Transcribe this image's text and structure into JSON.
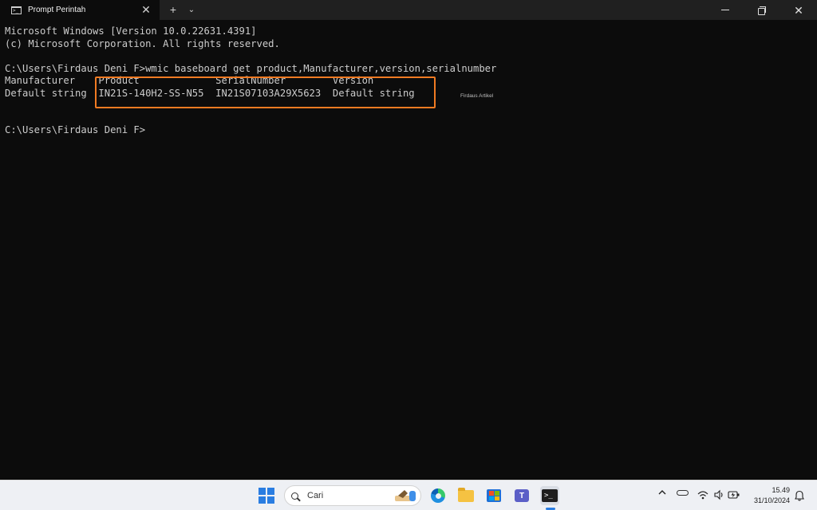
{
  "window": {
    "tab_title": "Prompt Perintah",
    "tab_icon": "terminal-icon",
    "tab_close_glyph": "✕",
    "new_tab_glyph": "+",
    "dropdown_glyph": "⌄",
    "close_glyph": "✕"
  },
  "console": {
    "lines": [
      "Microsoft Windows [Version 10.0.22631.4391]",
      "(c) Microsoft Corporation. All rights reserved.",
      "",
      "C:\\Users\\Firdaus Deni F>wmic baseboard get product,Manufacturer,version,serialnumber",
      "Manufacturer    Product             SerialNumber        Version",
      "Default string  IN21S-140H2-SS-N55  IN21S07103A29X5623  Default string",
      "",
      "",
      "C:\\Users\\Firdaus Deni F>"
    ],
    "watermark": "Firdaus Artikel",
    "highlight_color": "#f07a22"
  },
  "taskbar": {
    "search_placeholder": "Cari",
    "time": "15.49",
    "date": "31/10/2024",
    "apps": [
      "windows-start-icon",
      "edge-icon",
      "file-explorer-icon",
      "microsoft-store-icon",
      "teams-icon",
      "terminal-icon"
    ],
    "tray_icons": [
      "chevron-up-icon",
      "onedrive-cloud-icon",
      "wifi-icon",
      "speaker-icon",
      "battery-icon",
      "bell-icon"
    ],
    "accent": "#2a7de1"
  }
}
